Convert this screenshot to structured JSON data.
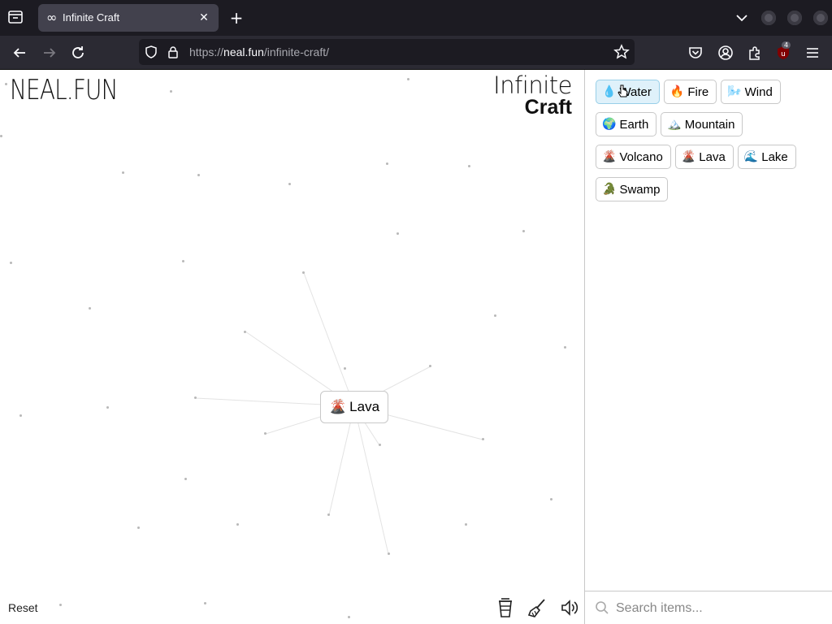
{
  "browser": {
    "tab": {
      "title": "Infinite Craft",
      "favicon": "∞",
      "close": "✕"
    },
    "new_tab": "+",
    "url": {
      "domain": "neal.fun",
      "prefix": "https://",
      "path": "/infinite-craft/"
    },
    "extension_badge": "4"
  },
  "page": {
    "brand": "NEAL.FUN",
    "title_line1": "Infinite",
    "title_line2": "Craft",
    "reset_label": "Reset",
    "canvas_item": {
      "emoji": "🌋",
      "label": "Lava"
    }
  },
  "sidebar": {
    "items": [
      {
        "emoji": "💧",
        "label": "Water"
      },
      {
        "emoji": "🔥",
        "label": "Fire"
      },
      {
        "emoji": "🌬️",
        "label": "Wind"
      },
      {
        "emoji": "🌍",
        "label": "Earth"
      },
      {
        "emoji": "🏔️",
        "label": "Mountain"
      },
      {
        "emoji": "🌋",
        "label": "Volcano"
      },
      {
        "emoji": "🌋",
        "label": "Lava"
      },
      {
        "emoji": "🌊",
        "label": "Lake"
      },
      {
        "emoji": "🐊",
        "label": "Swamp"
      }
    ],
    "search_placeholder": "Search items..."
  }
}
